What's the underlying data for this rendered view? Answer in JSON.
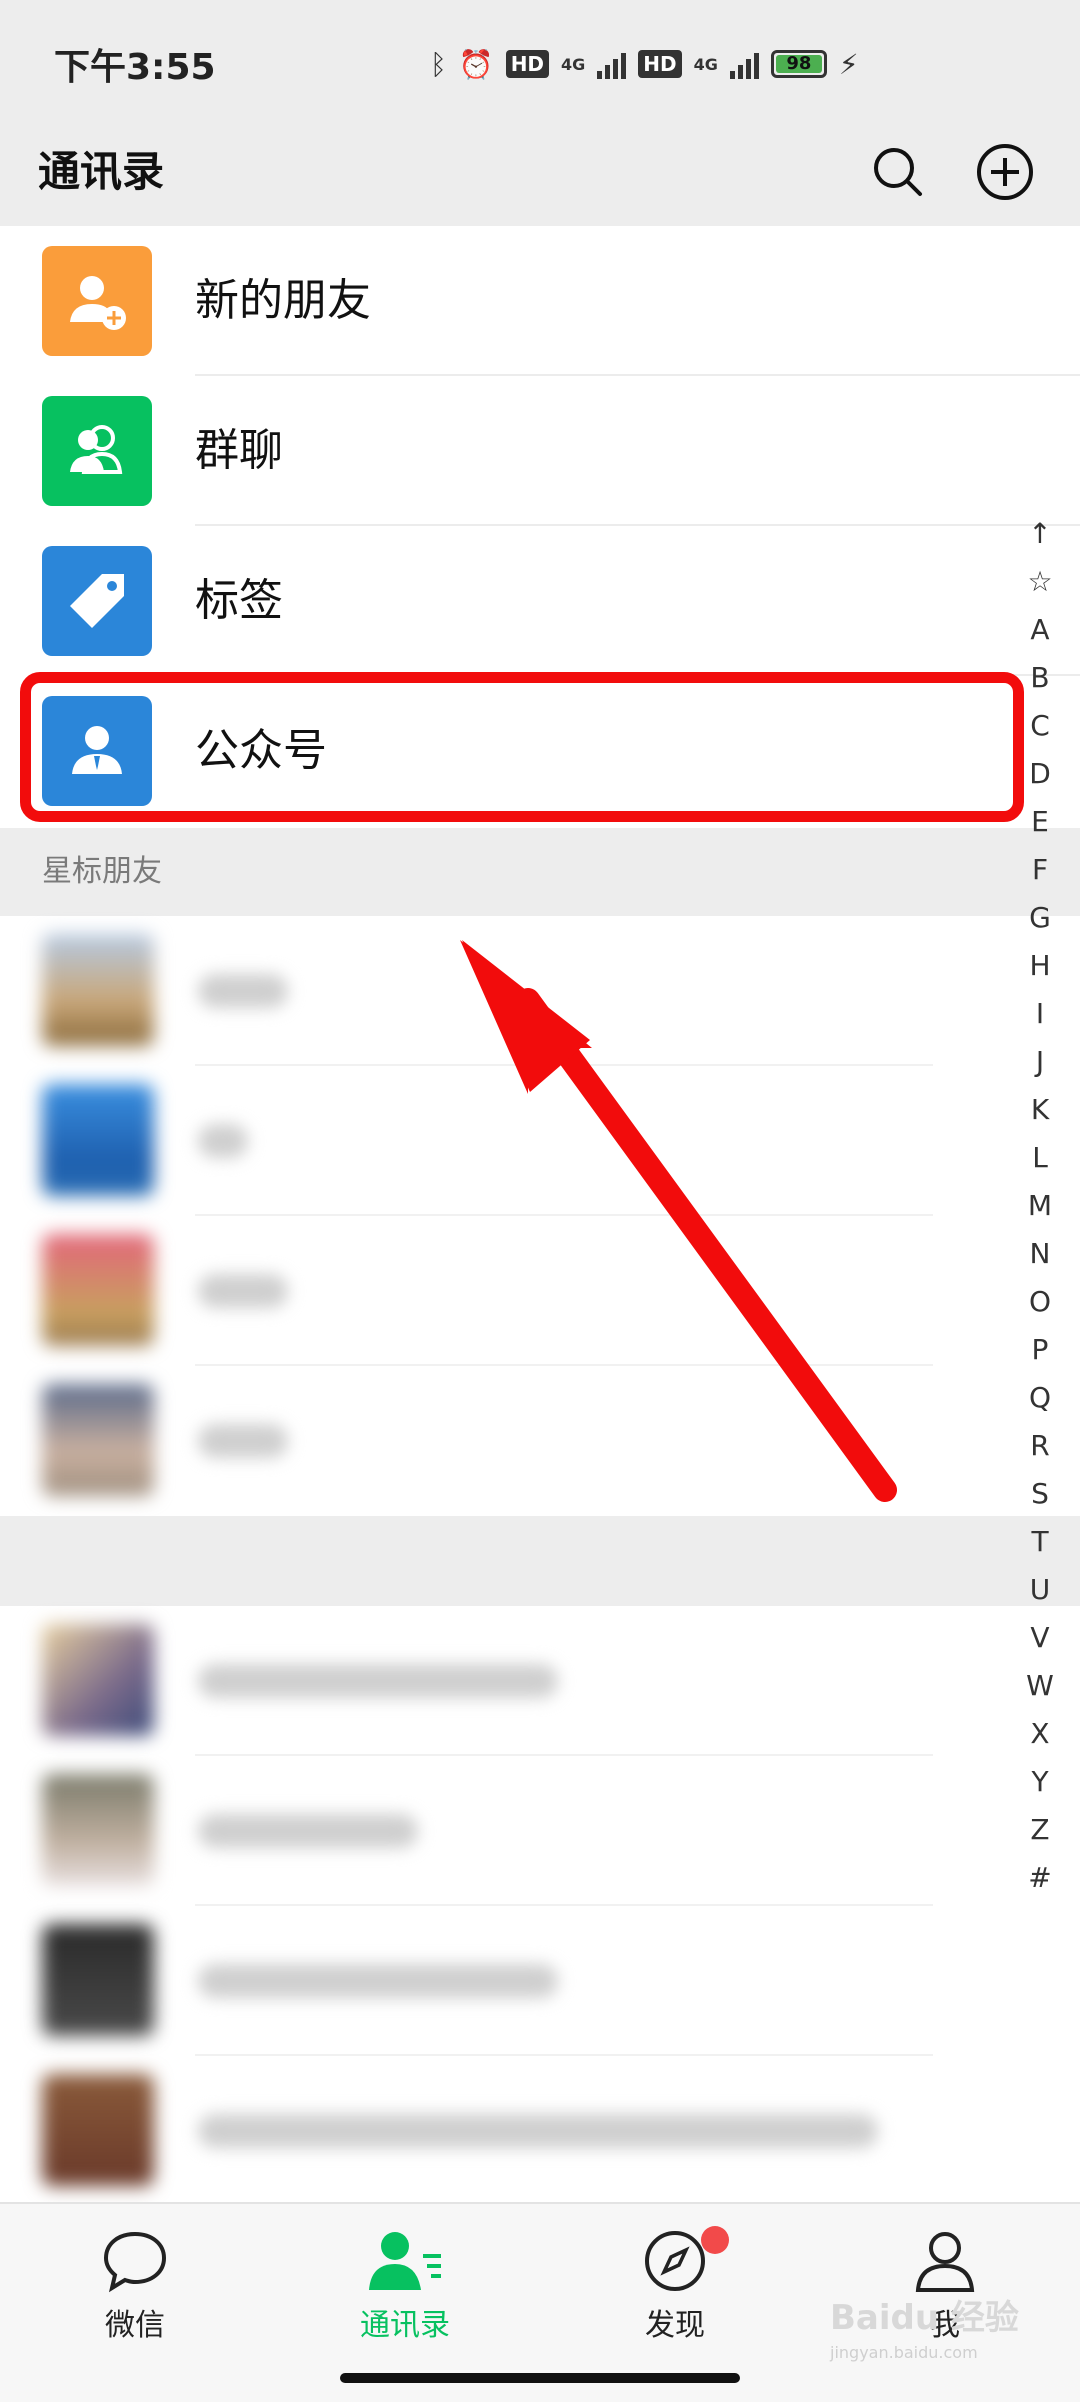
{
  "status": {
    "time": "下午3:55",
    "battery": "98",
    "network": "4G",
    "hd": "HD"
  },
  "header": {
    "title": "通讯录"
  },
  "menu": [
    {
      "label": "新的朋友",
      "icon": "add-friend-icon",
      "color": "#fa9d3b"
    },
    {
      "label": "群聊",
      "icon": "group-chat-icon",
      "color": "#07c160"
    },
    {
      "label": "标签",
      "icon": "tag-icon",
      "color": "#2b86d9"
    },
    {
      "label": "公众号",
      "icon": "official-account-icon",
      "color": "#2b86d9"
    }
  ],
  "section": {
    "starred": "星标朋友"
  },
  "index": [
    "↑",
    "☆",
    "A",
    "B",
    "C",
    "D",
    "E",
    "F",
    "G",
    "H",
    "I",
    "J",
    "K",
    "L",
    "M",
    "N",
    "O",
    "P",
    "Q",
    "R",
    "S",
    "T",
    "U",
    "V",
    "W",
    "X",
    "Y",
    "Z",
    "#"
  ],
  "tabs": [
    {
      "label": "微信",
      "icon": "chat-bubble-icon",
      "active": false
    },
    {
      "label": "通讯录",
      "icon": "contacts-icon",
      "active": true
    },
    {
      "label": "发现",
      "icon": "compass-icon",
      "active": false,
      "badge": true
    },
    {
      "label": "我",
      "icon": "person-icon",
      "active": false
    }
  ],
  "watermark": {
    "text": "Baidu 经验",
    "sub": "jingyan.baidu.com"
  },
  "colors": {
    "accent": "#07c160",
    "highlight": "#f20c0c",
    "badge": "#f24a4a"
  }
}
